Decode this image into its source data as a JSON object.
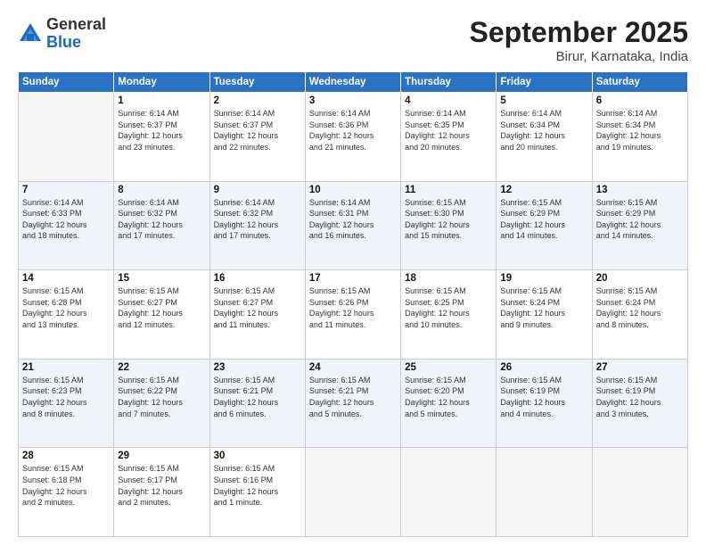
{
  "logo": {
    "general": "General",
    "blue": "Blue"
  },
  "title": "September 2025",
  "location": "Birur, Karnataka, India",
  "days_of_week": [
    "Sunday",
    "Monday",
    "Tuesday",
    "Wednesday",
    "Thursday",
    "Friday",
    "Saturday"
  ],
  "weeks": [
    [
      {
        "day": "",
        "info": ""
      },
      {
        "day": "1",
        "info": "Sunrise: 6:14 AM\nSunset: 6:37 PM\nDaylight: 12 hours\nand 23 minutes."
      },
      {
        "day": "2",
        "info": "Sunrise: 6:14 AM\nSunset: 6:37 PM\nDaylight: 12 hours\nand 22 minutes."
      },
      {
        "day": "3",
        "info": "Sunrise: 6:14 AM\nSunset: 6:36 PM\nDaylight: 12 hours\nand 21 minutes."
      },
      {
        "day": "4",
        "info": "Sunrise: 6:14 AM\nSunset: 6:35 PM\nDaylight: 12 hours\nand 20 minutes."
      },
      {
        "day": "5",
        "info": "Sunrise: 6:14 AM\nSunset: 6:34 PM\nDaylight: 12 hours\nand 20 minutes."
      },
      {
        "day": "6",
        "info": "Sunrise: 6:14 AM\nSunset: 6:34 PM\nDaylight: 12 hours\nand 19 minutes."
      }
    ],
    [
      {
        "day": "7",
        "info": "Sunrise: 6:14 AM\nSunset: 6:33 PM\nDaylight: 12 hours\nand 18 minutes."
      },
      {
        "day": "8",
        "info": "Sunrise: 6:14 AM\nSunset: 6:32 PM\nDaylight: 12 hours\nand 17 minutes."
      },
      {
        "day": "9",
        "info": "Sunrise: 6:14 AM\nSunset: 6:32 PM\nDaylight: 12 hours\nand 17 minutes."
      },
      {
        "day": "10",
        "info": "Sunrise: 6:14 AM\nSunset: 6:31 PM\nDaylight: 12 hours\nand 16 minutes."
      },
      {
        "day": "11",
        "info": "Sunrise: 6:15 AM\nSunset: 6:30 PM\nDaylight: 12 hours\nand 15 minutes."
      },
      {
        "day": "12",
        "info": "Sunrise: 6:15 AM\nSunset: 6:29 PM\nDaylight: 12 hours\nand 14 minutes."
      },
      {
        "day": "13",
        "info": "Sunrise: 6:15 AM\nSunset: 6:29 PM\nDaylight: 12 hours\nand 14 minutes."
      }
    ],
    [
      {
        "day": "14",
        "info": "Sunrise: 6:15 AM\nSunset: 6:28 PM\nDaylight: 12 hours\nand 13 minutes."
      },
      {
        "day": "15",
        "info": "Sunrise: 6:15 AM\nSunset: 6:27 PM\nDaylight: 12 hours\nand 12 minutes."
      },
      {
        "day": "16",
        "info": "Sunrise: 6:15 AM\nSunset: 6:27 PM\nDaylight: 12 hours\nand 11 minutes."
      },
      {
        "day": "17",
        "info": "Sunrise: 6:15 AM\nSunset: 6:26 PM\nDaylight: 12 hours\nand 11 minutes."
      },
      {
        "day": "18",
        "info": "Sunrise: 6:15 AM\nSunset: 6:25 PM\nDaylight: 12 hours\nand 10 minutes."
      },
      {
        "day": "19",
        "info": "Sunrise: 6:15 AM\nSunset: 6:24 PM\nDaylight: 12 hours\nand 9 minutes."
      },
      {
        "day": "20",
        "info": "Sunrise: 6:15 AM\nSunset: 6:24 PM\nDaylight: 12 hours\nand 8 minutes."
      }
    ],
    [
      {
        "day": "21",
        "info": "Sunrise: 6:15 AM\nSunset: 6:23 PM\nDaylight: 12 hours\nand 8 minutes."
      },
      {
        "day": "22",
        "info": "Sunrise: 6:15 AM\nSunset: 6:22 PM\nDaylight: 12 hours\nand 7 minutes."
      },
      {
        "day": "23",
        "info": "Sunrise: 6:15 AM\nSunset: 6:21 PM\nDaylight: 12 hours\nand 6 minutes."
      },
      {
        "day": "24",
        "info": "Sunrise: 6:15 AM\nSunset: 6:21 PM\nDaylight: 12 hours\nand 5 minutes."
      },
      {
        "day": "25",
        "info": "Sunrise: 6:15 AM\nSunset: 6:20 PM\nDaylight: 12 hours\nand 5 minutes."
      },
      {
        "day": "26",
        "info": "Sunrise: 6:15 AM\nSunset: 6:19 PM\nDaylight: 12 hours\nand 4 minutes."
      },
      {
        "day": "27",
        "info": "Sunrise: 6:15 AM\nSunset: 6:19 PM\nDaylight: 12 hours\nand 3 minutes."
      }
    ],
    [
      {
        "day": "28",
        "info": "Sunrise: 6:15 AM\nSunset: 6:18 PM\nDaylight: 12 hours\nand 2 minutes."
      },
      {
        "day": "29",
        "info": "Sunrise: 6:15 AM\nSunset: 6:17 PM\nDaylight: 12 hours\nand 2 minutes."
      },
      {
        "day": "30",
        "info": "Sunrise: 6:15 AM\nSunset: 6:16 PM\nDaylight: 12 hours\nand 1 minute."
      },
      {
        "day": "",
        "info": ""
      },
      {
        "day": "",
        "info": ""
      },
      {
        "day": "",
        "info": ""
      },
      {
        "day": "",
        "info": ""
      }
    ]
  ]
}
